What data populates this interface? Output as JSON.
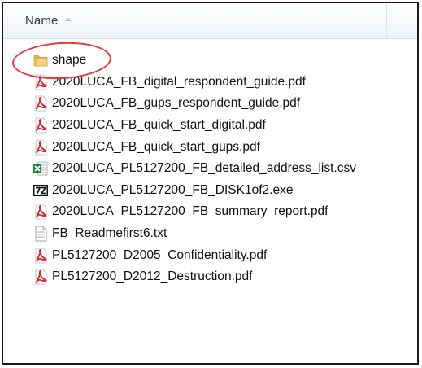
{
  "header": {
    "name_label": "Name"
  },
  "files": [
    {
      "name": "shape",
      "icon": "folder-icon"
    },
    {
      "name": "2020LUCA_FB_digital_respondent_guide.pdf",
      "icon": "pdf-icon"
    },
    {
      "name": "2020LUCA_FB_gups_respondent_guide.pdf",
      "icon": "pdf-icon"
    },
    {
      "name": "2020LUCA_FB_quick_start_digital.pdf",
      "icon": "pdf-icon"
    },
    {
      "name": "2020LUCA_FB_quick_start_gups.pdf",
      "icon": "pdf-icon"
    },
    {
      "name": "2020LUCA_PL5127200_FB_detailed_address_list.csv",
      "icon": "excel-csv-icon"
    },
    {
      "name": "2020LUCA_PL5127200_FB_DISK1of2.exe",
      "icon": "7zip-icon"
    },
    {
      "name": "2020LUCA_PL5127200_FB_summary_report.pdf",
      "icon": "pdf-icon"
    },
    {
      "name": "FB_Readmefirst6.txt",
      "icon": "text-file-icon"
    },
    {
      "name": "PL5127200_D2005_Confidentiality.pdf",
      "icon": "pdf-icon"
    },
    {
      "name": "PL5127200_D2012_Destruction.pdf",
      "icon": "pdf-icon"
    }
  ],
  "colors": {
    "highlight_ring": "#e8383d",
    "pdf_red": "#d9232e",
    "folder_yellow": "#e9c35a",
    "excel_green": "#1f7a3a"
  }
}
